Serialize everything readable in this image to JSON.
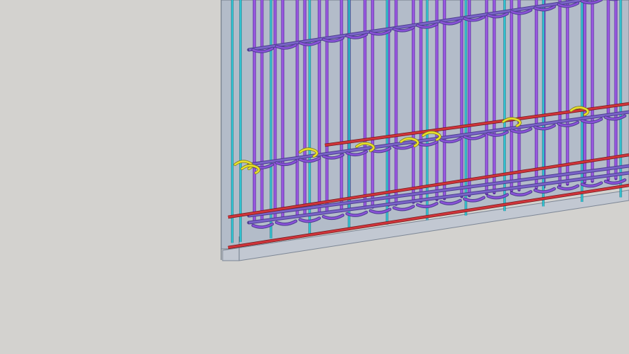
{
  "viewport": {
    "background": "#d3d2cf",
    "wall_fill": "#b3bcc9",
    "wall_edge": "#6f7a88",
    "base_fill": "#c2c8d2"
  },
  "colors": {
    "vertical_bar": "#9a5ae0",
    "vertical_bar_edge": "#5a2ea0",
    "outer_vertical": "#35c9d8",
    "horizontal_bar": "#7a63c8",
    "stirrup": "#8a52d8",
    "bottom_rebar": "#d0343a",
    "ties": "#e8df2a",
    "ties_edge": "#7c7a20"
  },
  "icons": [
    "rebar-cage-model"
  ]
}
